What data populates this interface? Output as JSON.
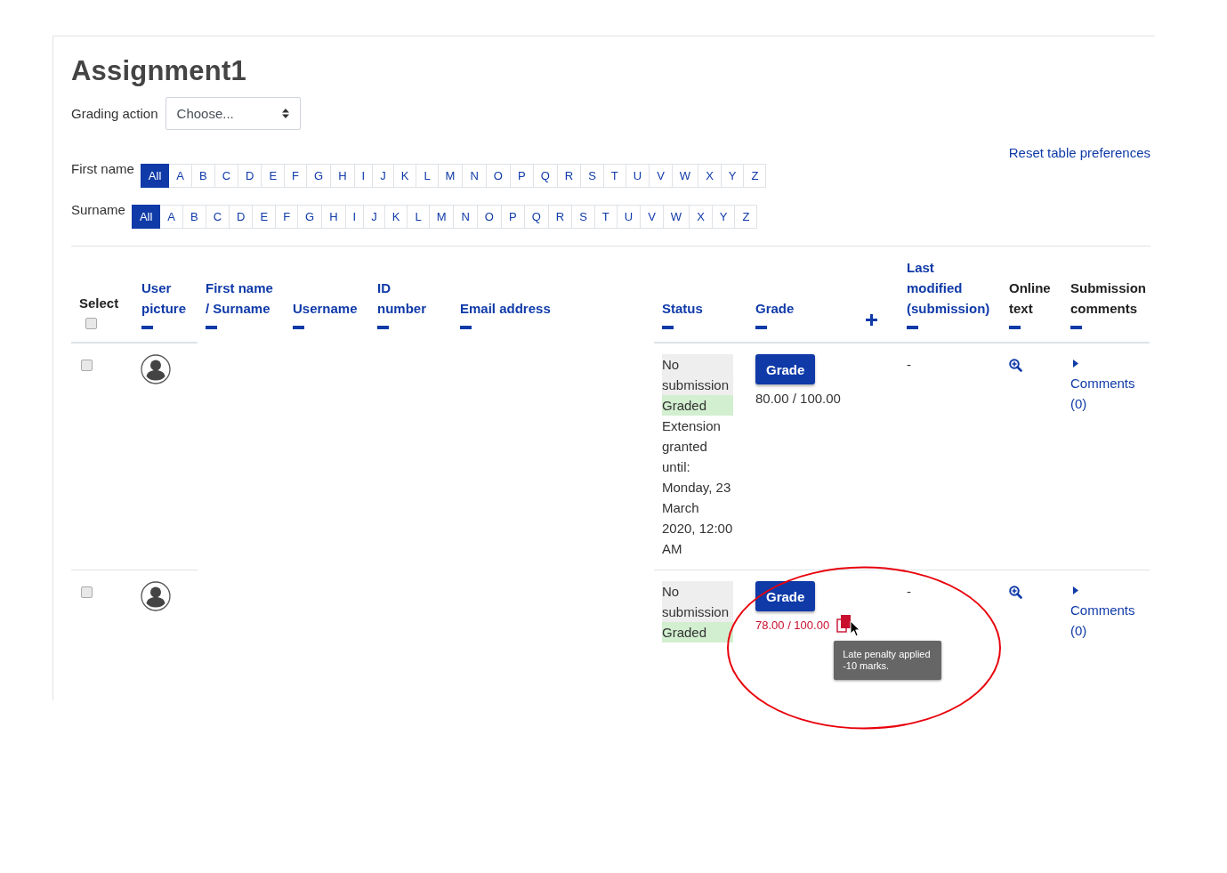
{
  "page_title": "Assignment1",
  "grading_action": {
    "label": "Grading action",
    "value": "Choose..."
  },
  "reset_link": "Reset table preferences",
  "initials_bars": [
    {
      "label": "First name",
      "letters": [
        {
          "text": "All",
          "selected": true
        },
        {
          "text": "A",
          "selected": false
        },
        {
          "text": "B",
          "selected": false
        },
        {
          "text": "C",
          "selected": false
        },
        {
          "text": "D",
          "selected": false
        },
        {
          "text": "E",
          "selected": false
        },
        {
          "text": "F",
          "selected": false
        },
        {
          "text": "G",
          "selected": false
        },
        {
          "text": "H",
          "selected": false
        },
        {
          "text": "I",
          "selected": false
        },
        {
          "text": "J",
          "selected": false
        },
        {
          "text": "K",
          "selected": false
        },
        {
          "text": "L",
          "selected": false
        },
        {
          "text": "M",
          "selected": false
        },
        {
          "text": "N",
          "selected": false
        },
        {
          "text": "O",
          "selected": false
        },
        {
          "text": "P",
          "selected": false
        },
        {
          "text": "Q",
          "selected": false
        },
        {
          "text": "R",
          "selected": false
        },
        {
          "text": "S",
          "selected": false
        },
        {
          "text": "T",
          "selected": false
        },
        {
          "text": "U",
          "selected": false
        },
        {
          "text": "V",
          "selected": false
        },
        {
          "text": "W",
          "selected": false
        },
        {
          "text": "X",
          "selected": false
        },
        {
          "text": "Y",
          "selected": false
        },
        {
          "text": "Z",
          "selected": false
        }
      ]
    },
    {
      "label": "Surname",
      "letters": [
        {
          "text": "All",
          "selected": true
        },
        {
          "text": "A",
          "selected": false
        },
        {
          "text": "B",
          "selected": false
        },
        {
          "text": "C",
          "selected": false
        },
        {
          "text": "D",
          "selected": false
        },
        {
          "text": "E",
          "selected": false
        },
        {
          "text": "F",
          "selected": false
        },
        {
          "text": "G",
          "selected": false
        },
        {
          "text": "H",
          "selected": false
        },
        {
          "text": "I",
          "selected": false
        },
        {
          "text": "J",
          "selected": false
        },
        {
          "text": "K",
          "selected": false
        },
        {
          "text": "L",
          "selected": false
        },
        {
          "text": "M",
          "selected": false
        },
        {
          "text": "N",
          "selected": false
        },
        {
          "text": "O",
          "selected": false
        },
        {
          "text": "P",
          "selected": false
        },
        {
          "text": "Q",
          "selected": false
        },
        {
          "text": "R",
          "selected": false
        },
        {
          "text": "S",
          "selected": false
        },
        {
          "text": "T",
          "selected": false
        },
        {
          "text": "U",
          "selected": false
        },
        {
          "text": "V",
          "selected": false
        },
        {
          "text": "W",
          "selected": false
        },
        {
          "text": "X",
          "selected": false
        },
        {
          "text": "Y",
          "selected": false
        },
        {
          "text": "Z",
          "selected": false
        }
      ]
    }
  ],
  "table": {
    "columns": [
      {
        "label": "Select",
        "kind": "select",
        "checked": false
      },
      {
        "label": "User picture",
        "kind": "sortable",
        "expand_toggle": false
      },
      {
        "label": "First name / Surname",
        "kind": "sortable",
        "expand_toggle": false
      },
      {
        "label": "Username",
        "kind": "sortable",
        "expand_toggle": false
      },
      {
        "label": "ID number",
        "kind": "sortable",
        "expand_toggle": false
      },
      {
        "label": "Email address",
        "kind": "sortable",
        "expand_toggle": false
      },
      {
        "label": "Status",
        "kind": "sortable",
        "expand_toggle": false
      },
      {
        "label": "Grade",
        "kind": "sortable",
        "expand_toggle": true
      },
      {
        "label": "Last modified (submission)",
        "kind": "sortable",
        "expand_toggle": false
      },
      {
        "label": "Online text",
        "kind": "plain",
        "expand_toggle": false
      },
      {
        "label": "Submission comments",
        "kind": "plain",
        "expand_toggle": false
      }
    ],
    "rows": [
      {
        "selected": false,
        "status": [
          {
            "text": "No submission",
            "kind": "no_submission"
          },
          {
            "text": "Graded",
            "kind": "graded"
          },
          {
            "text": "Extension granted until: Monday, 23 March 2020, 12:00 AM",
            "kind": "note"
          }
        ],
        "grade_button": "Grade",
        "grade": "80.00 / 100.00",
        "penalty": false,
        "last_modified": "-",
        "comments": "Comments (0)"
      },
      {
        "selected": false,
        "status": [
          {
            "text": "No submission",
            "kind": "no_submission"
          },
          {
            "text": "Graded",
            "kind": "graded"
          }
        ],
        "grade_button": "Grade",
        "grade": "78.00 / 100.00",
        "penalty": true,
        "tooltip": "Late penalty applied\n-10 marks.",
        "last_modified": "-",
        "comments": "Comments (0)"
      }
    ]
  }
}
